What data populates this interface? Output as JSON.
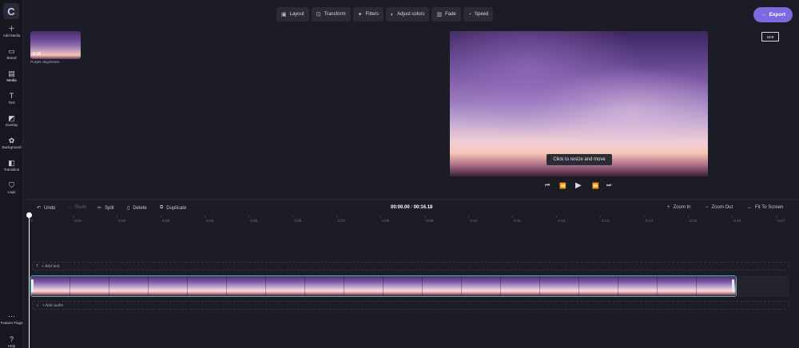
{
  "app": {
    "logo": "C"
  },
  "rail": [
    {
      "icon": "＋",
      "label": "Add Media"
    },
    {
      "icon": "▭",
      "label": "Brand"
    },
    {
      "icon": "▤",
      "label": "Media"
    },
    {
      "icon": "T",
      "label": "Text"
    },
    {
      "icon": "◩",
      "label": "Overlay"
    },
    {
      "icon": "✿",
      "label": "Background"
    },
    {
      "icon": "◧",
      "label": "Transition"
    },
    {
      "icon": "⛉",
      "label": "Logo"
    }
  ],
  "rail_bottom": [
    {
      "icon": "⋯",
      "label": "Feature Flags"
    },
    {
      "icon": "?",
      "label": "Help"
    }
  ],
  "toolbar": [
    {
      "icon": "▣",
      "label": "Layout"
    },
    {
      "icon": "⊡",
      "label": "Transform"
    },
    {
      "icon": "✦",
      "label": "Filters"
    },
    {
      "icon": "◐",
      "label": "Adjust colors"
    },
    {
      "icon": "▥",
      "label": "Fade"
    },
    {
      "icon": "◔",
      "label": "Speed"
    }
  ],
  "export": {
    "icon": "→",
    "label": "Export"
  },
  "ratio": "16:9",
  "media": {
    "duration": "0:16",
    "name": "Purple daydream"
  },
  "preview": {
    "tooltip": "Click to resize and move"
  },
  "playback": {
    "skip_back": "⏮",
    "rewind": "⏪",
    "play": "▶",
    "forward": "⏩",
    "skip_forward": "⏭"
  },
  "timeline": {
    "undo": "Undo",
    "redo": "Redo",
    "split": "Split",
    "delete": "Delete",
    "duplicate": "Duplicate",
    "current_time": "00:00.00",
    "separator": " / ",
    "total_time": "00:16.18",
    "zoom_in": "Zoom In",
    "zoom_out": "Zoom Out",
    "fit": "Fit To Screen",
    "ticks": [
      "0",
      "0:01",
      "0:02",
      "0:03",
      "0:04",
      "0:05",
      "0:06",
      "0:07",
      "0:08",
      "0:09",
      "0:10",
      "0:11",
      "0:12",
      "0:13",
      "0:14",
      "0:15",
      "0:16",
      "0:17"
    ],
    "add_text": "+ Add text",
    "add_audio": "+ Add audio"
  },
  "colors": {
    "accent": "#7b6ae0",
    "clip_border": "#4fb3a4",
    "background": "#1c1c26"
  }
}
